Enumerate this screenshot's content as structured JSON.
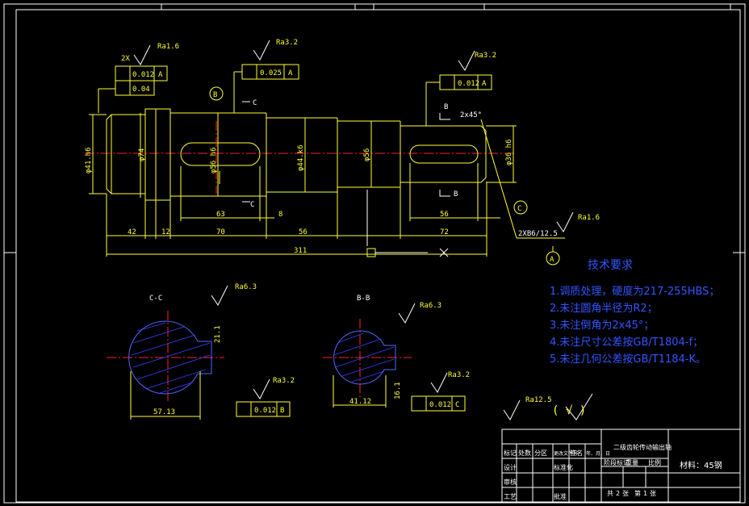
{
  "dims": {
    "d1": "φ41.h6",
    "d_collar": "φ74",
    "d2": "φ56 h6",
    "d3": "φ44.k6",
    "d4": "φ56",
    "d5": "φ36 h6",
    "l_key1": "63",
    "l_8": "8",
    "l_42": "42",
    "l_12": "12",
    "l_70": "70",
    "l_56a": "56",
    "l_56b": "56",
    "l_72": "72",
    "l_total": "311",
    "chamfer": "2x45°",
    "center_hole": "2XB6/12.5",
    "sec_cc_w": "57.13",
    "sec_bb_w": "41.12",
    "sec_cc_key": "21.1",
    "sec_bb_key": "16.1"
  },
  "roughness": {
    "r1": "Ra1.6",
    "r2": "Ra3.2",
    "r3": "Ra3.2",
    "r4": "Ra1.6",
    "r5": "Ra6.3",
    "r6": "Ra3.2",
    "r7": "Ra6.3",
    "r8": "Ra3.2",
    "r_general": "Ra12.5",
    "r_check": "( √ )"
  },
  "tolerance": {
    "prefix": "2X",
    "t1a": "0.012",
    "t1a_ref": "A",
    "t1b": "0.04",
    "t2": "0.025",
    "t2_ref": "A",
    "t3": "0.012",
    "t3_ref": "A",
    "t4": "0.012",
    "t4_ref": "B",
    "t5": "0.012",
    "t5_ref": "C"
  },
  "datums": {
    "a": "A",
    "b": "B",
    "c": "C",
    "sec_c": "C",
    "sec_c2": "C",
    "sec_b": "B",
    "sec_b2": "B"
  },
  "sections": {
    "cc": "C-C",
    "bb": "B-B"
  },
  "tech": {
    "title": "技术要求",
    "items": [
      "1.调质处理，硬度为217-255HBS；",
      "2.未注圆角半径为R2；",
      "3.未注倒角为2x45°；",
      "4.未注尺寸公差按GB/T1804-f；",
      "5.未注几何公差按GB/T1184-K。"
    ]
  },
  "titleblock": {
    "part_name": "二级齿轮传动输出轴",
    "material": "材料：45钢",
    "r1": [
      "标记",
      "处数",
      "分区",
      "更改文件号",
      "签名",
      "年、月、日"
    ],
    "r2": [
      "设计",
      "",
      "",
      "标准化",
      ""
    ],
    "r3": [
      "审核",
      ""
    ],
    "r4": [
      "工艺",
      "",
      "",
      "批准",
      ""
    ],
    "stage": "阶段标记",
    "weight": "重量",
    "scale": "比例",
    "sheets": "共",
    "sheet": "第",
    "sheet_of": "张",
    "sheet_n": "1",
    "sheet_t": "2"
  },
  "colors": {
    "drawing": "#ffff33",
    "center": "#ff2020",
    "tech_text": "#3355ff",
    "frame": "#ffffff"
  }
}
